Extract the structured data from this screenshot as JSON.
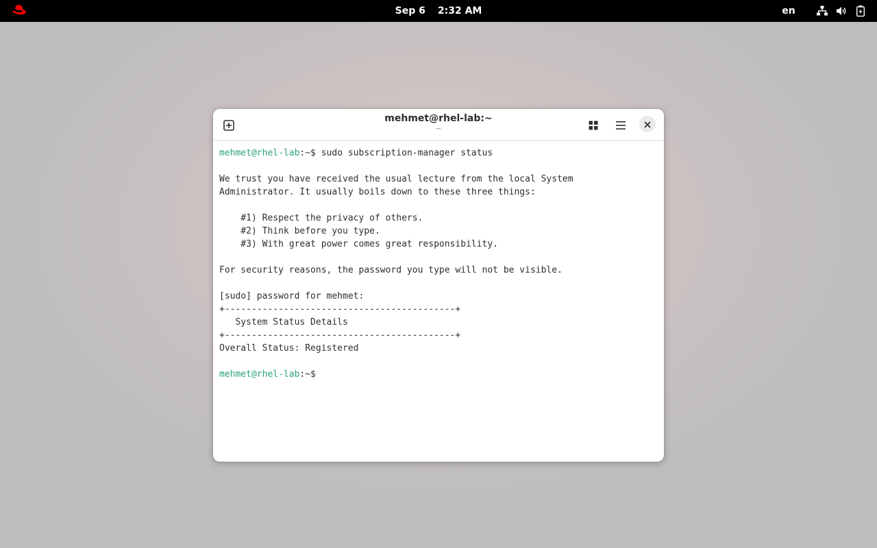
{
  "topbar": {
    "date": "Sep 6",
    "time": "2:32 AM",
    "language": "en"
  },
  "window": {
    "title": "mehmet@rhel-lab:~",
    "subtitle": "~"
  },
  "terminal": {
    "lines": [
      {
        "prompt_user": "mehmet@rhel-lab",
        "prompt_rest": ":~$ ",
        "text": "sudo subscription-manager status"
      },
      {
        "text": ""
      },
      {
        "text": "We trust you have received the usual lecture from the local System"
      },
      {
        "text": "Administrator. It usually boils down to these three things:"
      },
      {
        "text": ""
      },
      {
        "text": "    #1) Respect the privacy of others."
      },
      {
        "text": "    #2) Think before you type."
      },
      {
        "text": "    #3) With great power comes great responsibility."
      },
      {
        "text": ""
      },
      {
        "text": "For security reasons, the password you type will not be visible."
      },
      {
        "text": ""
      },
      {
        "text": "[sudo] password for mehmet:"
      },
      {
        "text": "+-------------------------------------------+"
      },
      {
        "text": "   System Status Details"
      },
      {
        "text": "+-------------------------------------------+"
      },
      {
        "text": "Overall Status: Registered"
      },
      {
        "text": ""
      },
      {
        "prompt_user": "mehmet@rhel-lab",
        "prompt_rest": ":~$",
        "text": ""
      }
    ]
  },
  "colors": {
    "prompt": "#2aa27c",
    "topbar": "#000000"
  }
}
